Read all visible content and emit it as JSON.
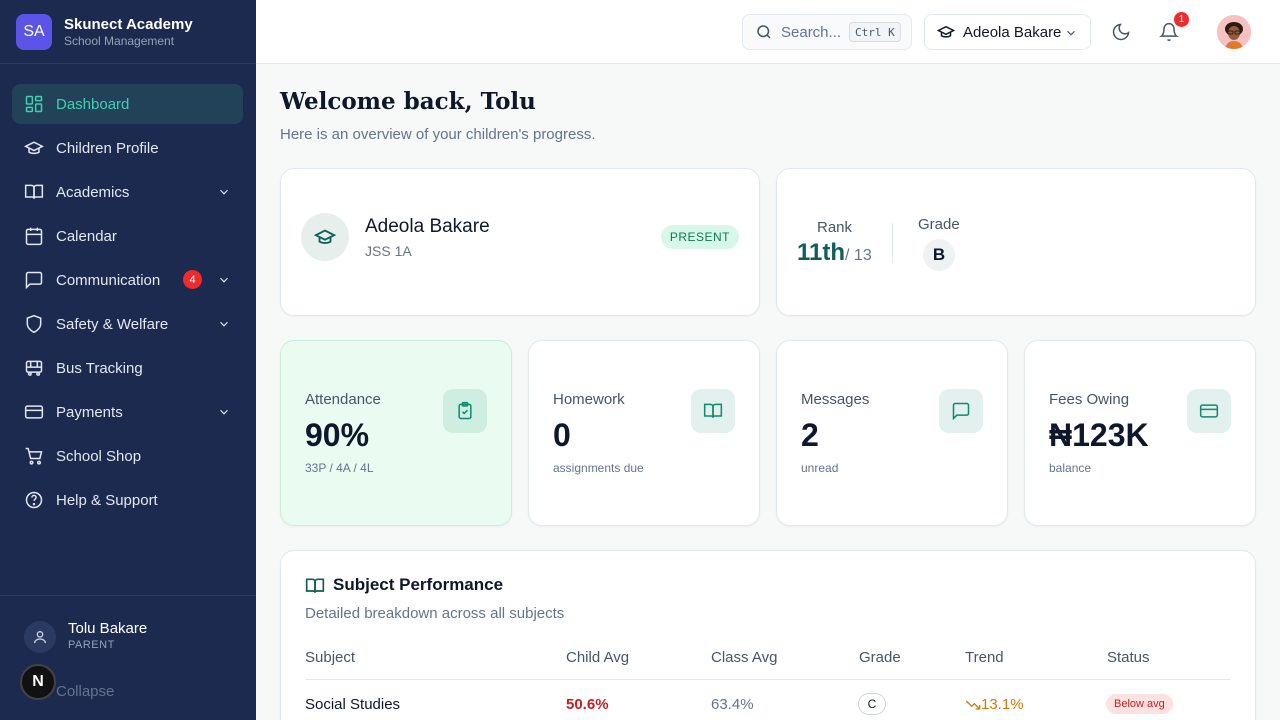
{
  "brand": {
    "logo_text": "SA",
    "name": "Skunect Academy",
    "subtitle": "School Management"
  },
  "sidebar": {
    "items": [
      {
        "label": "Dashboard",
        "icon": "dashboard-grid-icon",
        "active": true
      },
      {
        "label": "Children Profile",
        "icon": "graduation-cap-icon"
      },
      {
        "label": "Academics",
        "icon": "book-open-icon",
        "expandable": true
      },
      {
        "label": "Calendar",
        "icon": "calendar-icon"
      },
      {
        "label": "Communication",
        "icon": "message-square-icon",
        "expandable": true,
        "badge": "4"
      },
      {
        "label": "Safety & Welfare",
        "icon": "shield-icon",
        "expandable": true
      },
      {
        "label": "Bus Tracking",
        "icon": "bus-icon"
      },
      {
        "label": "Payments",
        "icon": "credit-card-icon",
        "expandable": true
      },
      {
        "label": "School Shop",
        "icon": "shopping-cart-icon"
      },
      {
        "label": "Help & Support",
        "icon": "help-circle-icon"
      }
    ],
    "user": {
      "name": "Tolu Bakare",
      "role": "PARENT"
    },
    "collapse_label": "Collapse",
    "floating_badge": "N"
  },
  "header": {
    "search_placeholder": "Search...",
    "search_shortcut": "Ctrl K",
    "selected_child": "Adeola Bakare",
    "notification_count": "1"
  },
  "main": {
    "welcome": "Welcome back, Tolu",
    "subtitle": "Here is an overview of your children's progress.",
    "child_card": {
      "name": "Adeola Bakare",
      "class": "JSS 1A",
      "status": "PRESENT"
    },
    "rank_card": {
      "rank_label": "Rank",
      "rank": "11th",
      "rank_of": "/ 13",
      "grade_label": "Grade",
      "grade": "B"
    },
    "stats": [
      {
        "title": "Attendance",
        "value": "90%",
        "sub": "33P / 4A / 4L",
        "icon": "clipboard-check-icon"
      },
      {
        "title": "Homework",
        "value": "0",
        "sub": "assignments due",
        "icon": "book-open-icon"
      },
      {
        "title": "Messages",
        "value": "2",
        "sub": "unread",
        "icon": "message-square-icon"
      },
      {
        "title": "Fees Owing",
        "value": "₦123K",
        "sub": "balance",
        "icon": "credit-card-icon"
      }
    ],
    "performance": {
      "title": "Subject Performance",
      "subtitle": "Detailed breakdown across all subjects",
      "columns": [
        "Subject",
        "Child Avg",
        "Class Avg",
        "Grade",
        "Trend",
        "Status"
      ],
      "rows": [
        {
          "subject": "Social Studies",
          "child_avg": "50.6%",
          "class_avg": "63.4%",
          "grade": "C",
          "trend": "13.1%",
          "status": "Below avg"
        }
      ]
    }
  },
  "colors": {
    "sidebar": "#1b2a4e",
    "accent": "#3fd0b0",
    "danger": "#ef2b2b",
    "rank": "#0f5e58"
  }
}
